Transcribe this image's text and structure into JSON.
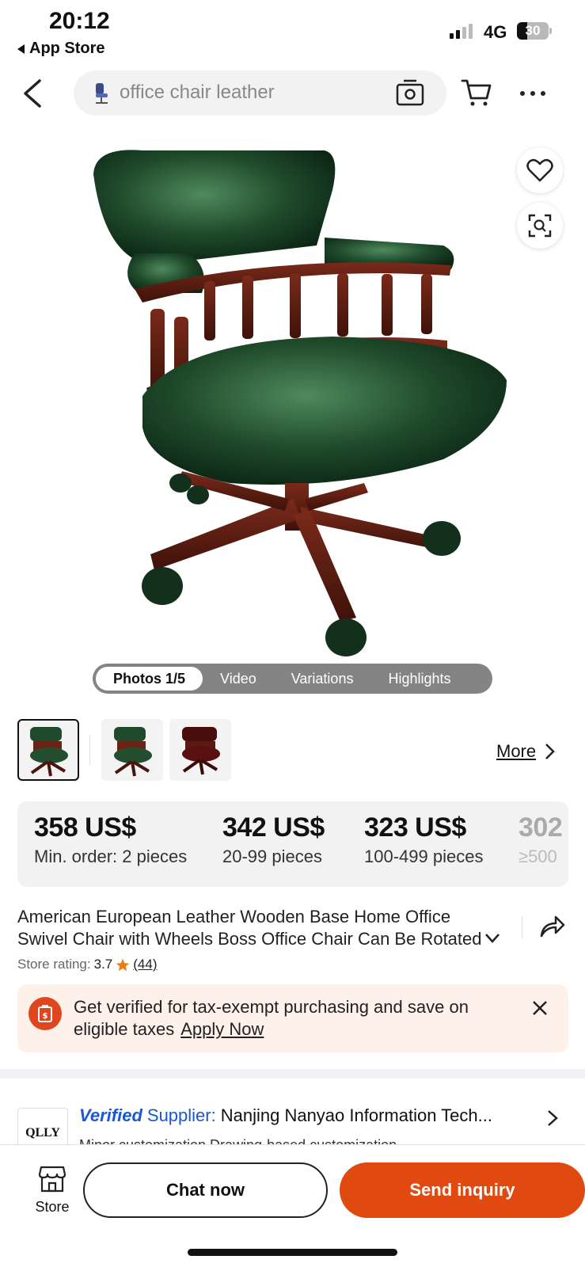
{
  "status_bar": {
    "time": "20:12",
    "back_app": "App Store",
    "network": "4G",
    "battery": "30"
  },
  "header": {
    "search_text": "office chair leather"
  },
  "media_tabs": [
    {
      "label": "Photos 1/5",
      "active": true
    },
    {
      "label": "Video",
      "active": false
    },
    {
      "label": "Variations",
      "active": false
    },
    {
      "label": "Highlights",
      "active": false
    }
  ],
  "thumbnails": {
    "more_label": "More"
  },
  "price_tiers": [
    {
      "price": "358 US$",
      "quantity": "Min. order: 2 pieces"
    },
    {
      "price": "342 US$",
      "quantity": "20-99 pieces"
    },
    {
      "price": "323 US$",
      "quantity": "100-499 pieces"
    },
    {
      "price": "302",
      "quantity": "≥500"
    }
  ],
  "product": {
    "title": "American European Leather Wooden Base Home Office Swivel Chair with Wheels Boss Office Chair Can Be Rotated",
    "rating_label": "Store rating:",
    "rating_value": "3.7",
    "rating_count": "(44)"
  },
  "tax_banner": {
    "text": "Get verified for tax-exempt purchasing and save on eligible taxes",
    "link": "Apply Now"
  },
  "supplier": {
    "logo_text": "QLLY",
    "verified": "Verified",
    "supplier_label": "Supplier:",
    "name": "Nanjing Nanyao Information Tech...",
    "sub": "Minor customization    Drawing-based customization"
  },
  "bottom_bar": {
    "store_label": "Store",
    "chat_label": "Chat now",
    "inquiry_label": "Send inquiry"
  },
  "colors": {
    "accent": "#e04a10",
    "verified_blue": "#1a57d6",
    "star": "#f07a14",
    "banner_bg": "#fef1ea"
  }
}
